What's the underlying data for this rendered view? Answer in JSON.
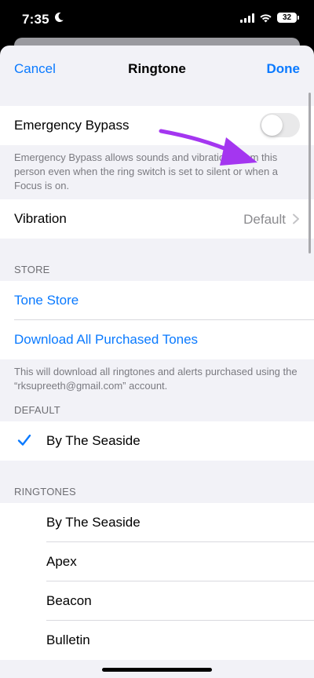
{
  "status": {
    "time": "7:35",
    "battery": "32"
  },
  "nav": {
    "cancel": "Cancel",
    "title": "Ringtone",
    "done": "Done"
  },
  "emergency": {
    "label": "Emergency Bypass",
    "enabled": false,
    "note": "Emergency Bypass allows sounds and vibrations from this person even when the ring switch is set to silent or when a Focus is on."
  },
  "vibration": {
    "label": "Vibration",
    "value": "Default"
  },
  "store": {
    "header": "STORE",
    "tone_store": "Tone Store",
    "download_all": "Download All Purchased Tones",
    "note": "This will download all ringtones and alerts purchased using the “rksupreeth@gmail.com” account."
  },
  "default": {
    "header": "DEFAULT",
    "selected": "By The Seaside"
  },
  "ringtones": {
    "header": "RINGTONES",
    "items": [
      "By The Seaside",
      "Apex",
      "Beacon",
      "Bulletin"
    ]
  },
  "colors": {
    "accent": "#0a7aff",
    "annotation_arrow": "#a436f0"
  }
}
